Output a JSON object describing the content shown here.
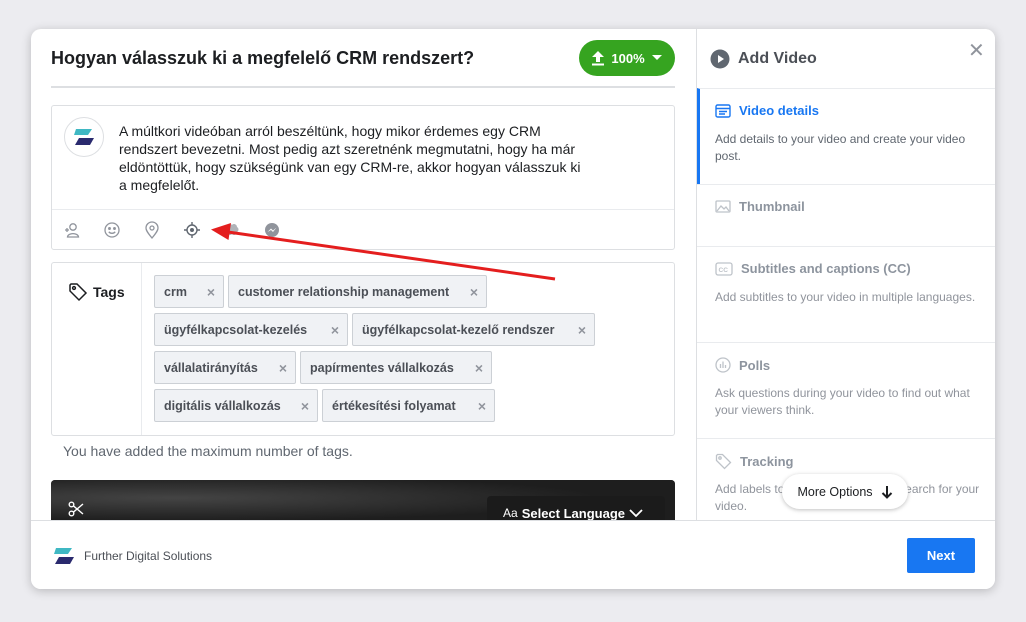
{
  "post": {
    "title": "Hogyan válasszuk ki a megfelelő CRM rendszert?",
    "upload_progress": "100%",
    "text": "A múltkori videóban arról beszéltünk, hogy mikor érdemes egy CRM rendszert bevezetni. Most pedig azt szeretnénk megmutatni, hogy ha már eldöntöttük, hogy szükségünk van egy CRM-re, akkor hogyan válasszuk ki a megfelelőt."
  },
  "composer_tools": [
    "tag-people-icon",
    "emoji-icon",
    "location-icon",
    "target-icon",
    "sponsor-icon",
    "messenger-icon"
  ],
  "tags": {
    "label": "Tags",
    "items": [
      "crm",
      "customer relationship management",
      "ügyfélkapcsolat-kezelés",
      "ügyfélkapcsolat-kezelő rendszer",
      "vállalatirányítás",
      "papírmentes vállalkozás",
      "digitális vállalkozás",
      "értékesítési folyamat"
    ],
    "limit_message": "You have added the maximum number of tags."
  },
  "video": {
    "language_button": "Select Language",
    "language_prefix": "Aa"
  },
  "footer": {
    "page_name": "Further Digital Solutions",
    "next_label": "Next"
  },
  "sidebar": {
    "title": "Add Video",
    "steps": [
      {
        "title": "Video details",
        "description": "Add details to your video and create your video post."
      },
      {
        "title": "Thumbnail",
        "description": ""
      },
      {
        "title": "Subtitles and captions (CC)",
        "description": "Add subtitles to your video in multiple languages."
      },
      {
        "title": "Polls",
        "description": "Ask questions during your video to find out what your viewers think."
      },
      {
        "title": "Tracking",
        "description": "Add labels to help people find and search for your video."
      }
    ],
    "more_options": "More Options"
  },
  "colors": {
    "accent": "#1877f2",
    "upload_green": "#36a420",
    "annotation_red": "#e41e1e"
  }
}
